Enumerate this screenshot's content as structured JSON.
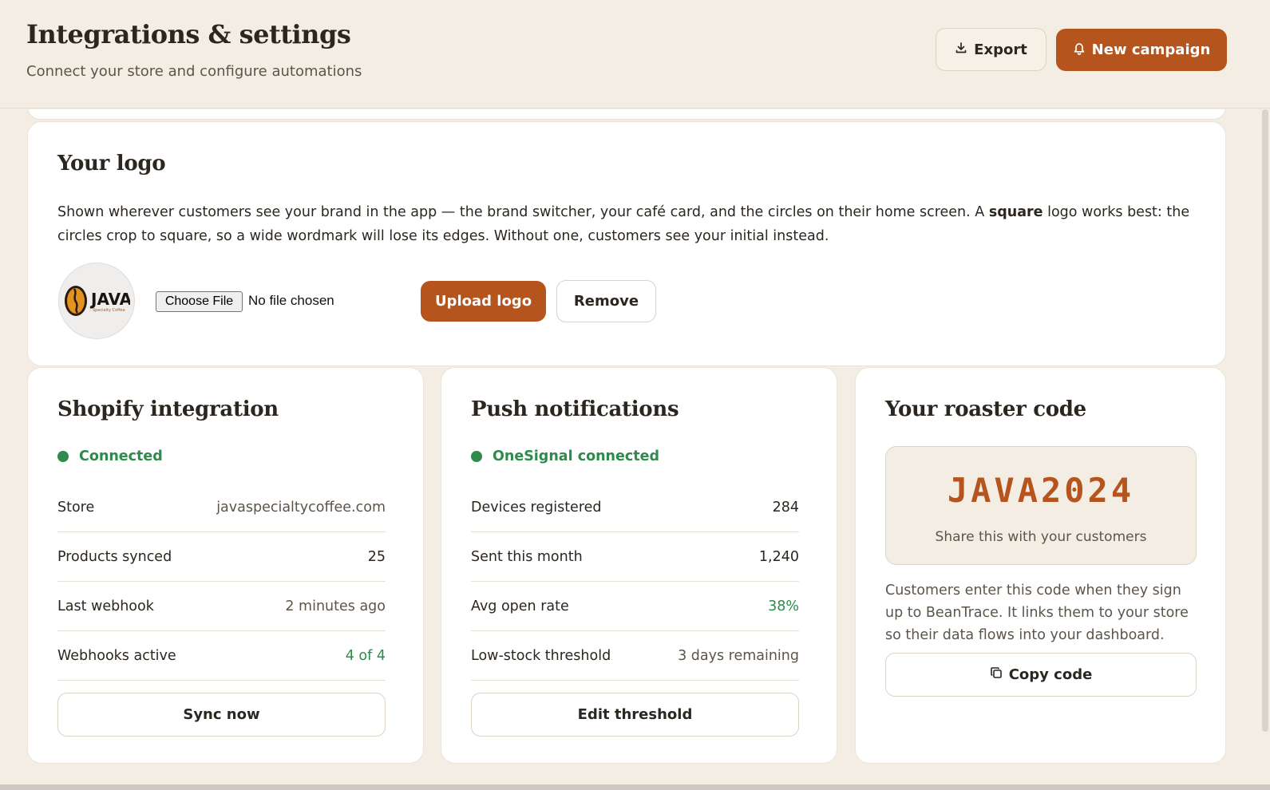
{
  "header": {
    "title": "Integrations & settings",
    "subtitle": "Connect your store and configure automations",
    "export_label": "Export",
    "new_campaign_label": "New campaign"
  },
  "logo_card": {
    "title": "Your logo",
    "desc_part1": "Shown wherever customers see your brand in the app — the brand switcher, your café card, and the circles on their home screen. A ",
    "desc_bold": "square",
    "desc_part2": " logo works best: the circles crop to square, so a wide wordmark will lose its edges. Without one, customers see your initial instead.",
    "logo_text": "JAVA",
    "logo_subtext": "Specialty Coffee",
    "choose_file_label": "Choose File",
    "file_status": "No file chosen",
    "upload_label": "Upload logo",
    "remove_label": "Remove"
  },
  "shopify": {
    "title": "Shopify integration",
    "status": "Connected",
    "rows": [
      {
        "label": "Store",
        "value": "javaspecialtycoffee.com"
      },
      {
        "label": "Products synced",
        "value": "25"
      },
      {
        "label": "Last webhook",
        "value": "2 minutes ago"
      },
      {
        "label": "Webhooks active",
        "value": "4 of 4"
      }
    ],
    "button_label": "Sync now"
  },
  "push": {
    "title": "Push notifications",
    "status": "OneSignal connected",
    "rows": [
      {
        "label": "Devices registered",
        "value": "284"
      },
      {
        "label": "Sent this month",
        "value": "1,240"
      },
      {
        "label": "Avg open rate",
        "value": "38%"
      },
      {
        "label": "Low-stock threshold",
        "value": "3 days remaining"
      }
    ],
    "button_label": "Edit threshold"
  },
  "roaster": {
    "title": "Your roaster code",
    "code": "JAVA2024",
    "caption": "Share this with your customers",
    "description": "Customers enter this code when they sign up to BeanTrace. It links them to your store so their data flows into your dashboard.",
    "button_label": "Copy code"
  },
  "colors": {
    "accent": "#b5541c",
    "success": "#2f8a4b",
    "background": "#f4ede3"
  },
  "icons": {
    "export": "download-icon",
    "new_campaign": "bell-icon",
    "copy": "copy-icon"
  }
}
